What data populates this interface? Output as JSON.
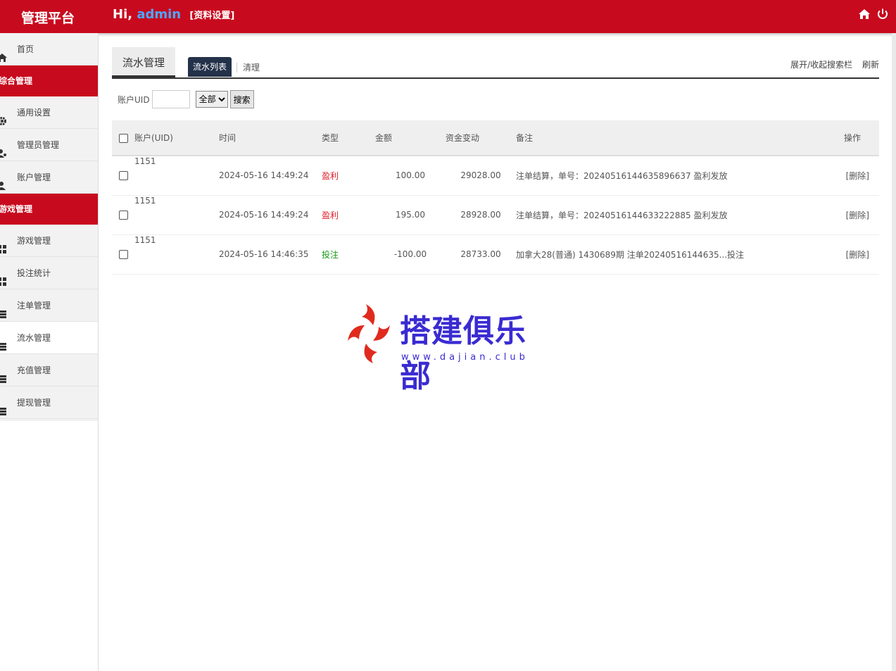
{
  "header": {
    "brand": "管理平台",
    "greeting_prefix": "Hi, ",
    "username": "admin",
    "profile_link": "[资料设置]"
  },
  "sidebar": {
    "items": [
      {
        "label": "首页",
        "icon": "home-icon"
      },
      {
        "group": "综合管理"
      },
      {
        "label": "通用设置",
        "icon": "gear-icon"
      },
      {
        "label": "管理员管理",
        "icon": "users-icon"
      },
      {
        "label": "账户管理",
        "icon": "user-icon"
      },
      {
        "group": "游戏管理"
      },
      {
        "label": "游戏管理",
        "icon": "grid-icon"
      },
      {
        "label": "投注统计",
        "icon": "grid-icon"
      },
      {
        "label": "注单管理",
        "icon": "list-icon"
      },
      {
        "label": "流水管理",
        "icon": "list-icon",
        "active": true
      },
      {
        "label": "充值管理",
        "icon": "list-icon"
      },
      {
        "label": "提现管理",
        "icon": "list-icon"
      }
    ]
  },
  "page": {
    "section_title": "流水管理",
    "tab_list": "流水列表",
    "tab_clean": "清理",
    "toggle_search": "展开/收起搜索栏",
    "refresh": "刷新"
  },
  "search": {
    "uid_label": "账户UID",
    "uid_value": "",
    "select_value": "全部",
    "search_button": "搜索"
  },
  "table": {
    "headers": [
      "账户(UID)",
      "时间",
      "类型",
      "金额",
      "资金变动",
      "备注",
      "操作"
    ],
    "rows": [
      {
        "uid": "1151",
        "time": "2024-05-16 14:49:24",
        "type": "盈利",
        "type_color": "#e0202a",
        "amount": "100.00",
        "balance": "29028.00",
        "note": "注单结算，单号：20240516144635896637 盈利发放",
        "op": "[删除]"
      },
      {
        "uid": "1151",
        "time": "2024-05-16 14:49:24",
        "type": "盈利",
        "type_color": "#e0202a",
        "amount": "195.00",
        "balance": "28928.00",
        "note": "注单结算，单号：20240516144633222885 盈利发放",
        "op": "[删除]"
      },
      {
        "uid": "1151",
        "time": "2024-05-16 14:46:35",
        "type": "投注",
        "type_color": "#1a9a1a",
        "amount": "-100.00",
        "balance": "28733.00",
        "note": "加拿大28(普通) 1430689期 注单20240516144635...投注",
        "op": "[删除]"
      }
    ]
  },
  "watermark": {
    "name": "搭建俱乐部",
    "url": "www.dajian.club"
  },
  "colors": {
    "header_red": "#c80a1e",
    "username_blue": "#4aa8ff",
    "tab_active_navy": "#23324a",
    "watermark_blue": "#3a2bd2"
  }
}
